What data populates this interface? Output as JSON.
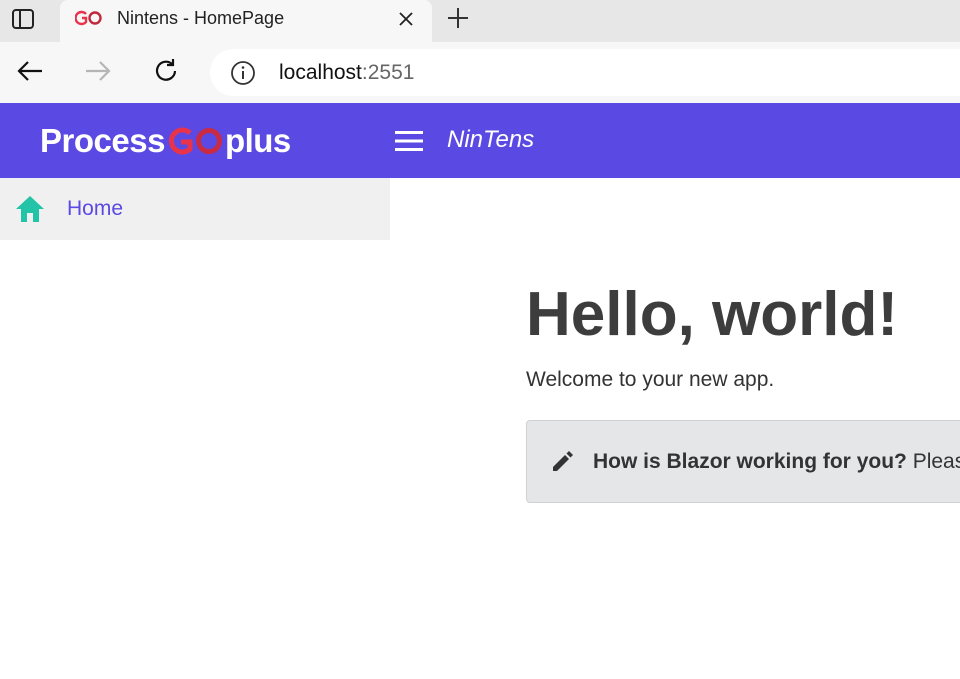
{
  "browser": {
    "tab_title": "Nintens - HomePage",
    "url_host": "localhost",
    "url_port": ":2551"
  },
  "header": {
    "logo_left": "Process",
    "logo_right": "plus",
    "app_title": "NinTens"
  },
  "sidebar": {
    "items": [
      {
        "label": "Home"
      }
    ]
  },
  "main": {
    "title": "Hello, world!",
    "welcome": "Welcome to your new app.",
    "survey_prompt": "How is Blazor working for you?",
    "survey_tail": " Pleas"
  },
  "colors": {
    "brand": "#5a4ae3",
    "home_icon": "#22c3a6",
    "logo_go_red": "#e8334a"
  }
}
